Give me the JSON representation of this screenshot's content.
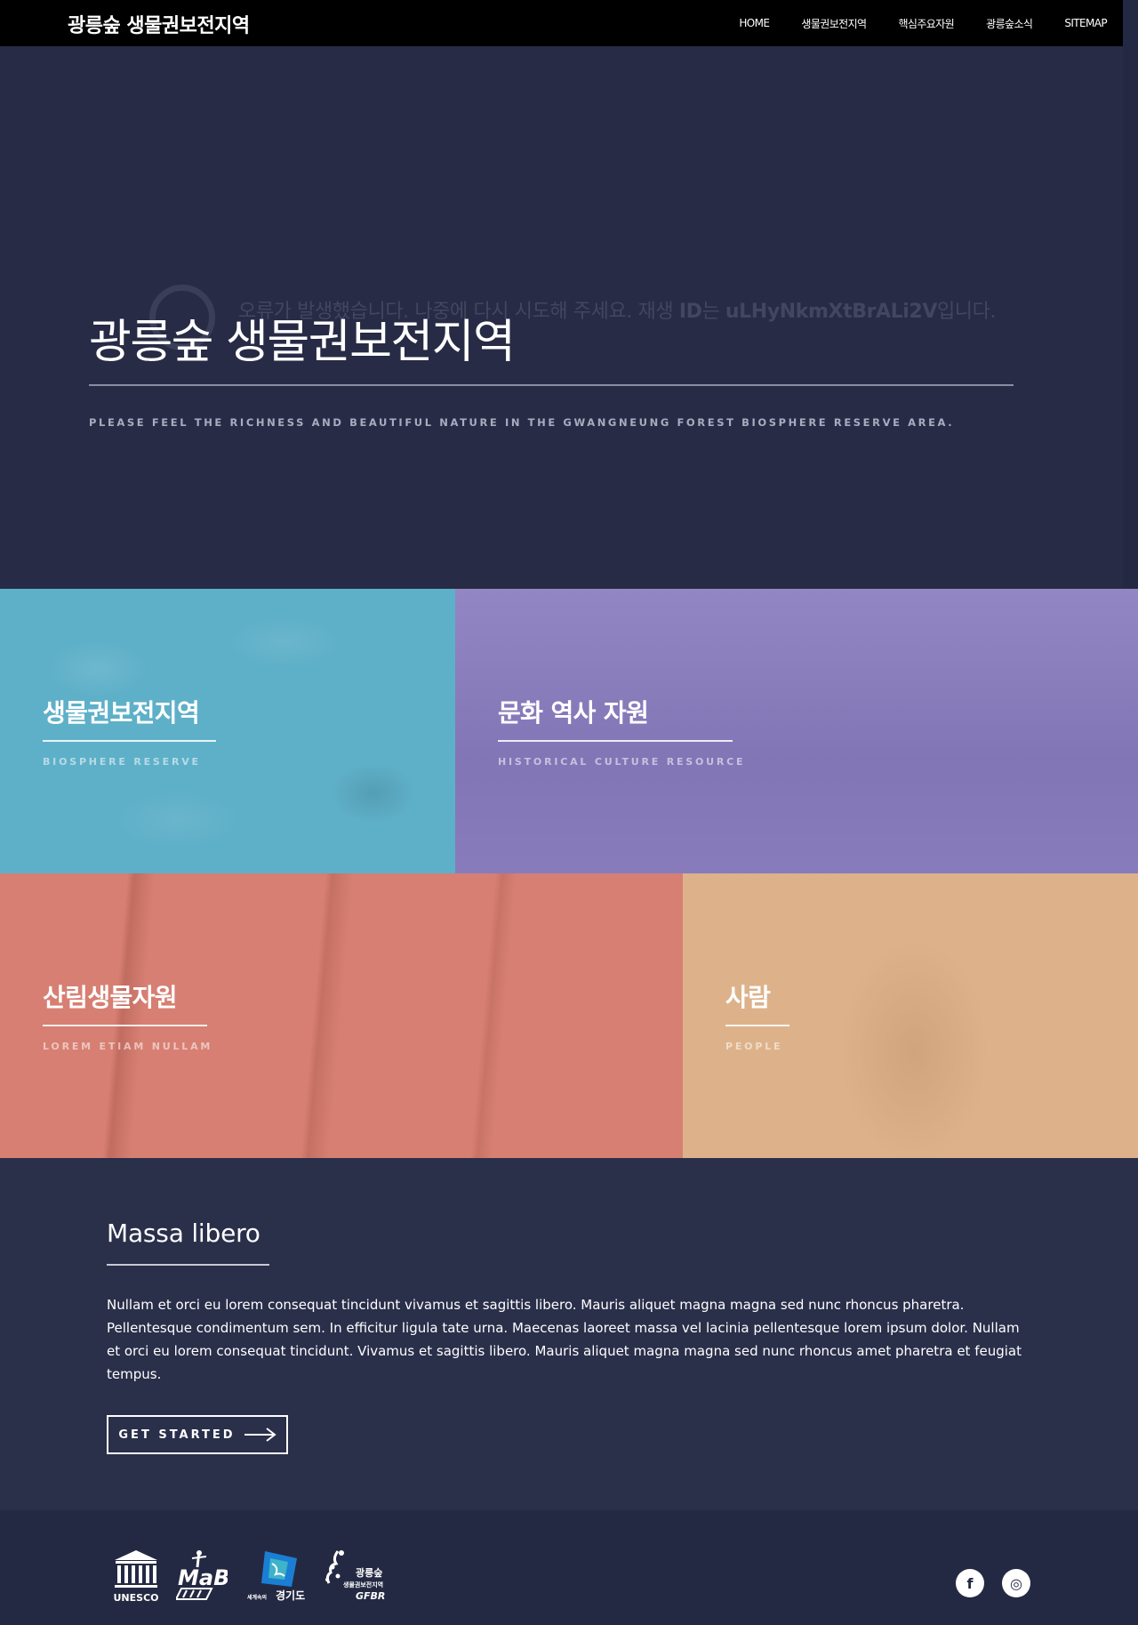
{
  "header": {
    "brand": "광릉숲 생물권보전지역",
    "nav": [
      "HOME",
      "생물권보전지역",
      "핵심주요자원",
      "광릉숲소식",
      "SITEMAP"
    ]
  },
  "hero": {
    "error_message": "오류가 발생했습니다. 나중에 다시 시도해 주세요. 재생 ID는 uLHyNkmXtBrALi2V입니다.",
    "title": "광릉숲 생물권보전지역",
    "subtitle": "PLEASE FEEL THE RICHNESS AND BEAUTIFUL NATURE IN THE GWANGNEUNG FOREST BIOSPHERE RESERVE AREA."
  },
  "tiles": [
    {
      "title": "생물권보전지역",
      "subtitle": "BIOSPHERE RESERVE",
      "color": "#5eb0c8"
    },
    {
      "title": "문화 역사 자원",
      "subtitle": "HISTORICAL CULTURE RESOURCE",
      "color": "#8c80c0"
    },
    {
      "title": "산림생물자원",
      "subtitle": "LOREM ETIAM NULLAM",
      "color": "#d77f73"
    },
    {
      "title": "사람",
      "subtitle": "PEOPLE",
      "color": "#ddb28a"
    }
  ],
  "section": {
    "title": "Massa libero",
    "body": "Nullam et orci eu lorem consequat tincidunt vivamus et sagittis libero. Mauris aliquet magna magna sed nunc rhoncus pharetra. Pellentesque condimentum sem. In efficitur ligula tate urna. Maecenas laoreet massa vel lacinia pellentesque lorem ipsum dolor. Nullam et orci eu lorem consequat tincidunt. Vivamus et sagittis libero. Mauris aliquet magna magna sed nunc rhoncus amet pharetra et feugiat tempus.",
    "button": "GET STARTED"
  },
  "footer": {
    "logos": [
      {
        "icon": "unesco-logo",
        "caption": "UNESCO",
        "mark": "UNESCO"
      },
      {
        "icon": "mab-logo",
        "mark": "MaB"
      },
      {
        "icon": "gyeonggi-logo",
        "caption": "경기도",
        "small": "세계속의"
      },
      {
        "icon": "gfbr-logo",
        "caption": "광릉숲",
        "caption2": "생물권보전지역",
        "caption3": "GFBR"
      }
    ],
    "social": [
      {
        "icon": "facebook-icon",
        "glyph": "f"
      },
      {
        "icon": "instagram-icon",
        "glyph": "◎"
      }
    ]
  },
  "colors": {
    "page": "#242943",
    "header": "#000000"
  }
}
